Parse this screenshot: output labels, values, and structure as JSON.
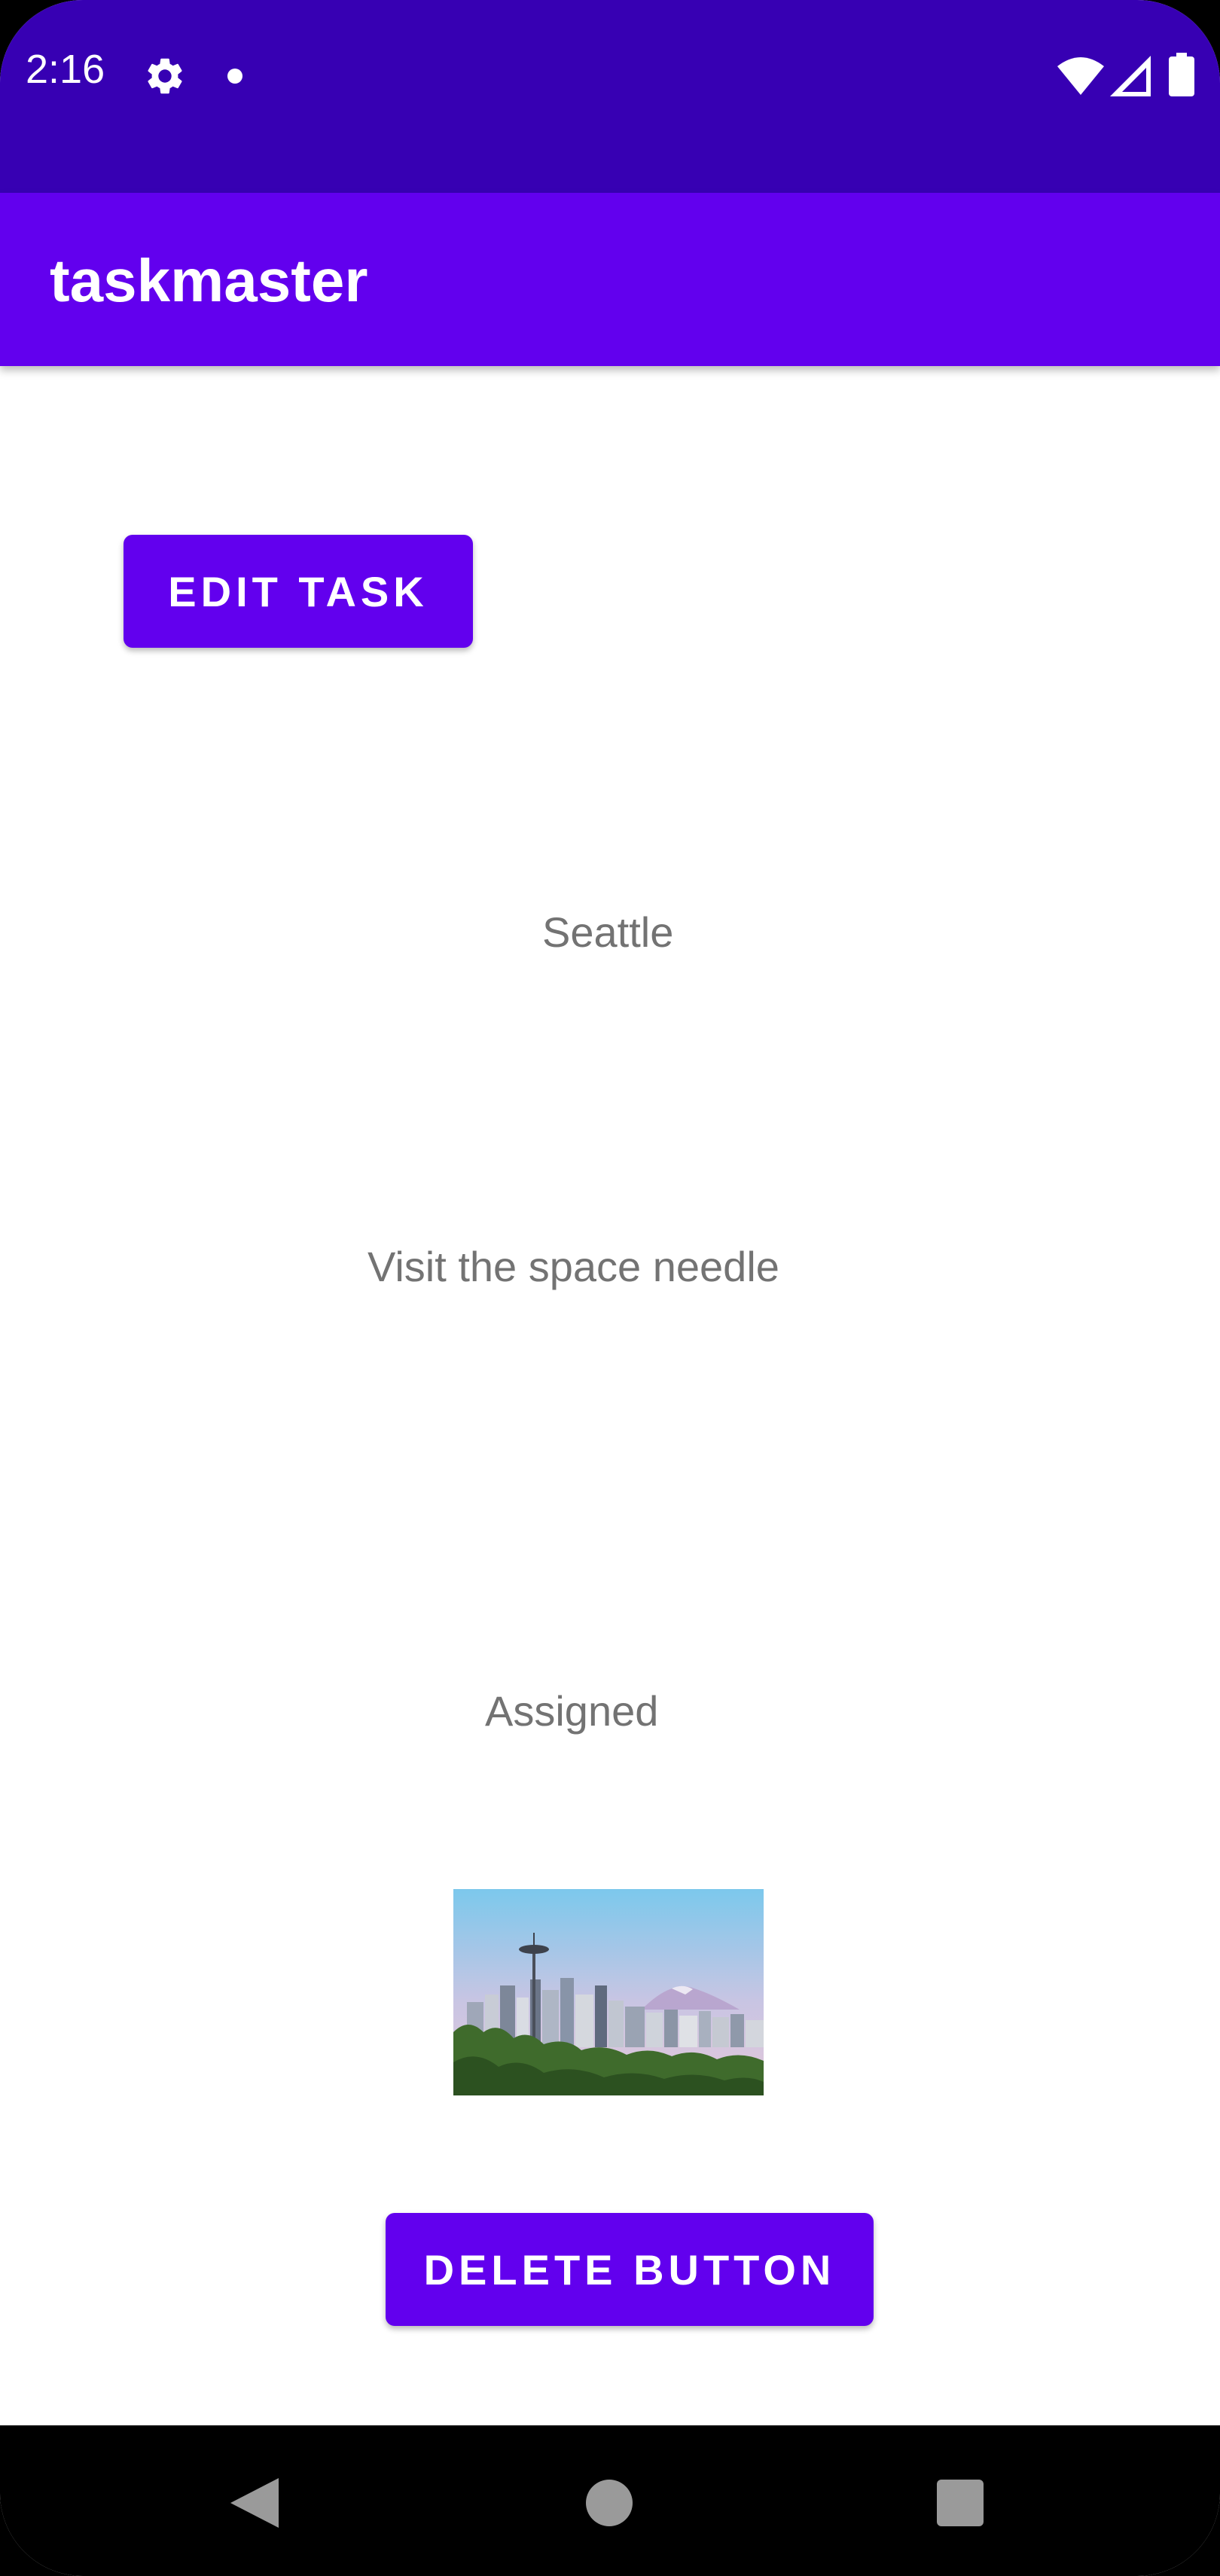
{
  "status_bar": {
    "time": "2:16",
    "icons": [
      "gear-icon",
      "notification-dot-icon",
      "wifi-icon",
      "signal-icon",
      "battery-icon"
    ]
  },
  "app_bar": {
    "title": "taskmaster"
  },
  "main": {
    "edit_button_label": "EDIT TASK",
    "task_title": "Seattle",
    "task_body": "Visit the space needle",
    "task_state": "Assigned",
    "task_image": "seattle-skyline-photo",
    "delete_button_label": "DELETE BUTTON"
  },
  "nav_bar": {
    "icons": [
      "back-icon",
      "home-icon",
      "recents-icon"
    ]
  },
  "colors": {
    "status_bar": "#3700b3",
    "primary": "#6200ee",
    "text_secondary": "#737373",
    "background": "#ffffff"
  }
}
